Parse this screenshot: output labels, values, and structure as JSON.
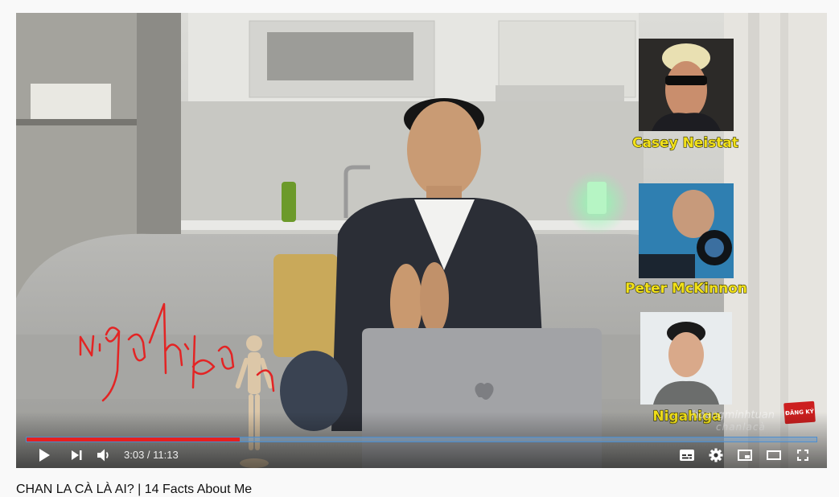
{
  "video": {
    "overlays": [
      {
        "name": "Casey Neistat"
      },
      {
        "name": "Peter McKinnon"
      },
      {
        "name": "Nigahiga"
      }
    ],
    "handwriting": "Nigahiga",
    "watermark_line1": "hoangminhtuan",
    "watermark_line2": "chanlacà",
    "subscribe_badge": "ĐĂNG KÝ"
  },
  "player": {
    "progress": 0.27,
    "loaded": 0.27,
    "current_time": "3:03",
    "duration": "11:13",
    "time_display": "3:03 / 11:13",
    "colors": {
      "progress": "#e52020",
      "track": "#78a0c8"
    },
    "icons": [
      "play-icon",
      "next-icon",
      "volume-icon",
      "subtitles-icon",
      "settings-icon",
      "miniplayer-icon",
      "theater-mode-icon",
      "fullscreen-icon"
    ]
  },
  "page": {
    "title": "CHAN LA CÀ LÀ AI? | 14 Facts About Me"
  }
}
